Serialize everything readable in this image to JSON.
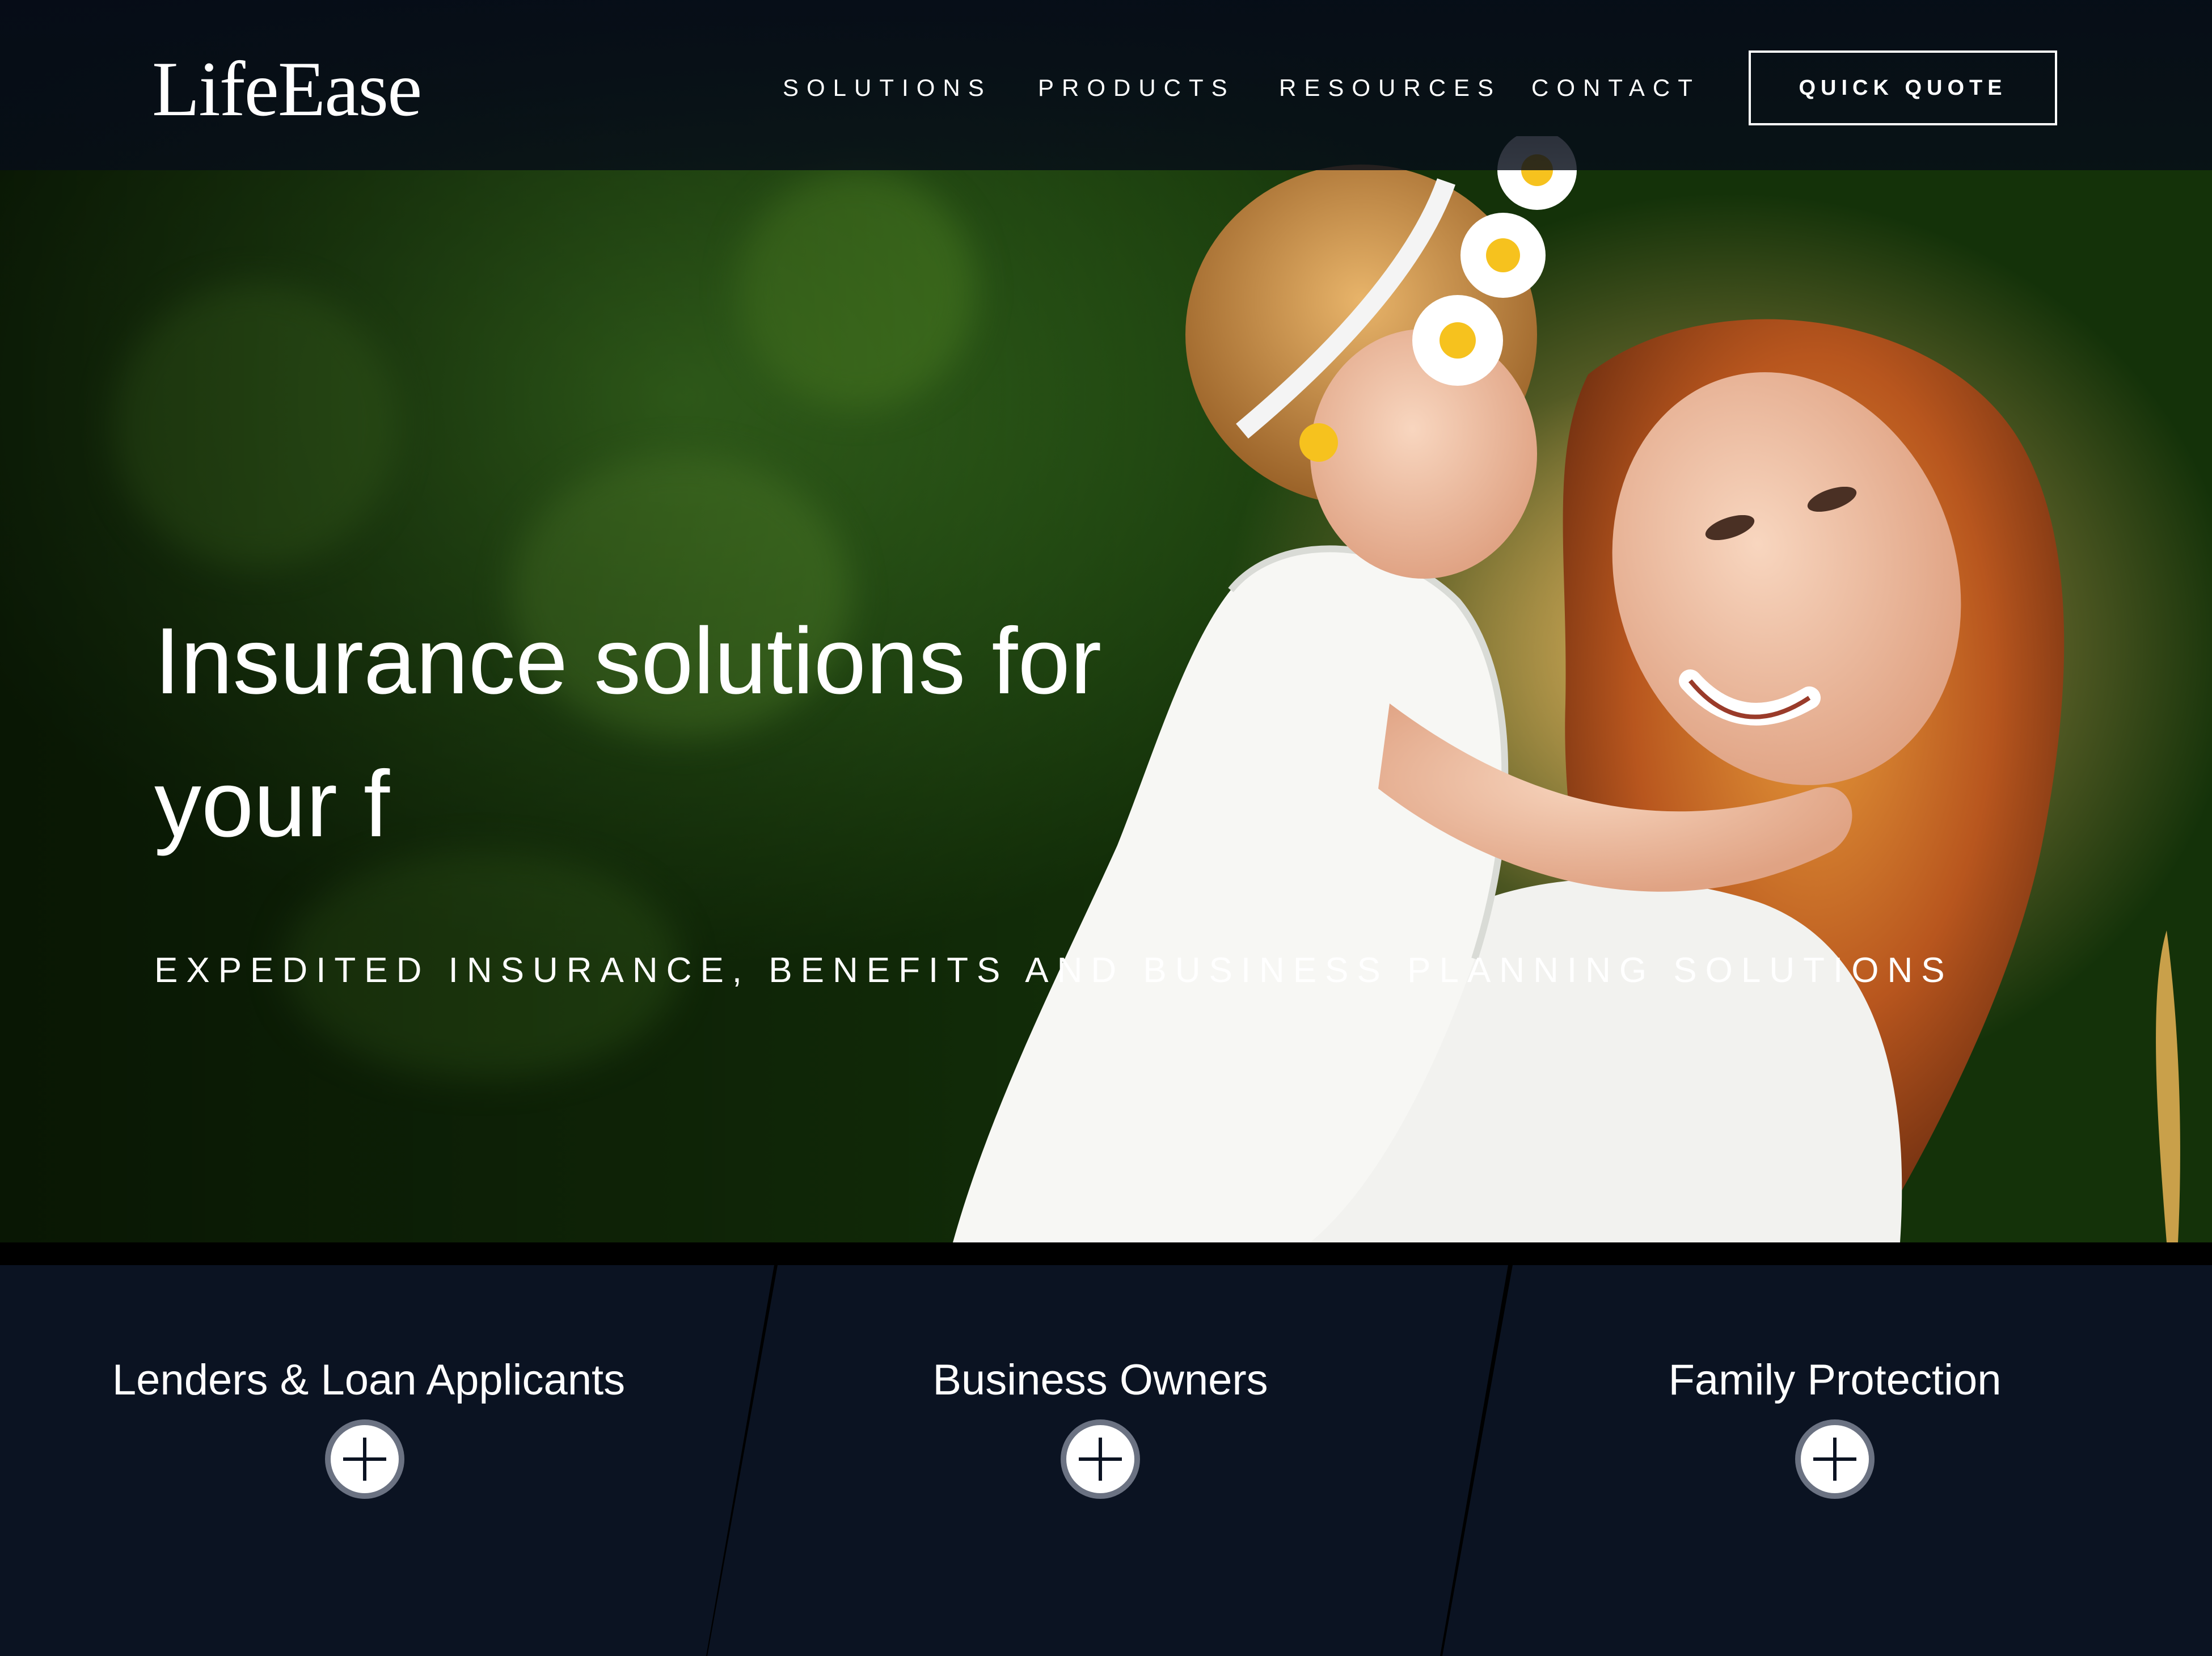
{
  "brand": {
    "logo_text": "LifeEase"
  },
  "nav": {
    "items": [
      {
        "label": "SOLUTIONS"
      },
      {
        "label": "PRODUCTS"
      },
      {
        "label": "RESOURCES"
      },
      {
        "label": "CONTACT"
      }
    ],
    "cta_label": "QUICK QUOTE"
  },
  "hero": {
    "title": "Insurance solutions for your f",
    "subtitle": "EXPEDITED INSURANCE, BENEFITS AND BUSINESS PLANNING SOLUTIONS",
    "image_icon": "mother-and-daughter-photo"
  },
  "categories": [
    {
      "title": "Lenders & Loan Applicants",
      "icon": "plus-icon"
    },
    {
      "title": "Business Owners",
      "icon": "plus-icon"
    },
    {
      "title": "Family Protection",
      "icon": "plus-icon"
    }
  ],
  "colors": {
    "navy": "#0b1322",
    "nav_bg": "#060c18",
    "text": "#ffffff",
    "button_ring": "#6b7282"
  }
}
